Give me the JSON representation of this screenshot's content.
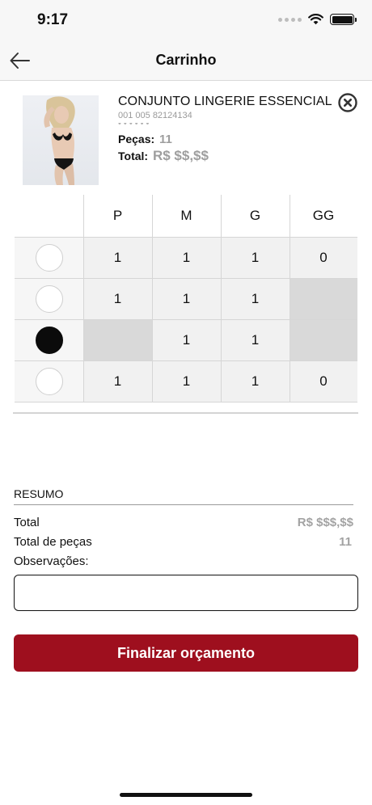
{
  "status_bar": {
    "time": "9:17",
    "icons": [
      "signal-icon",
      "wifi-icon",
      "battery-icon"
    ]
  },
  "nav": {
    "title": "Carrinho",
    "back_icon": "arrow-left-icon"
  },
  "product": {
    "name": "CONJUNTO LINGERIE ESSENCIAL",
    "code": "001 005 82124134",
    "pieces_label": "Peças:",
    "pieces_value": "11",
    "total_label": "Total:",
    "total_value": "R$ $$,$$",
    "remove_icon": "close-circle-icon"
  },
  "grid": {
    "sizes": [
      "P",
      "M",
      "G",
      "GG"
    ],
    "rows": [
      {
        "color": "#ffffff",
        "quantities": [
          "1",
          "1",
          "1",
          "0"
        ]
      },
      {
        "color": "#ffffff",
        "quantities": [
          "1",
          "1",
          "1",
          null
        ]
      },
      {
        "color": "#0b0b0b",
        "quantities": [
          null,
          "1",
          "1",
          null
        ]
      },
      {
        "color": "#ffffff",
        "quantities": [
          "1",
          "1",
          "1",
          "0"
        ]
      }
    ]
  },
  "summary": {
    "title": "RESUMO",
    "total_label": "Total",
    "total_value": "R$ $$$,$$",
    "pieces_label": "Total de peças",
    "pieces_value": "11",
    "notes_label": "Observações:",
    "notes_value": ""
  },
  "actions": {
    "submit_label": "Finalizar orçamento"
  },
  "colors": {
    "accent": "#9e0f1e",
    "muted_value": "#a3a3a3",
    "cell_bg": "#f1f1f1",
    "cell_disabled": "#d9d9d9"
  }
}
